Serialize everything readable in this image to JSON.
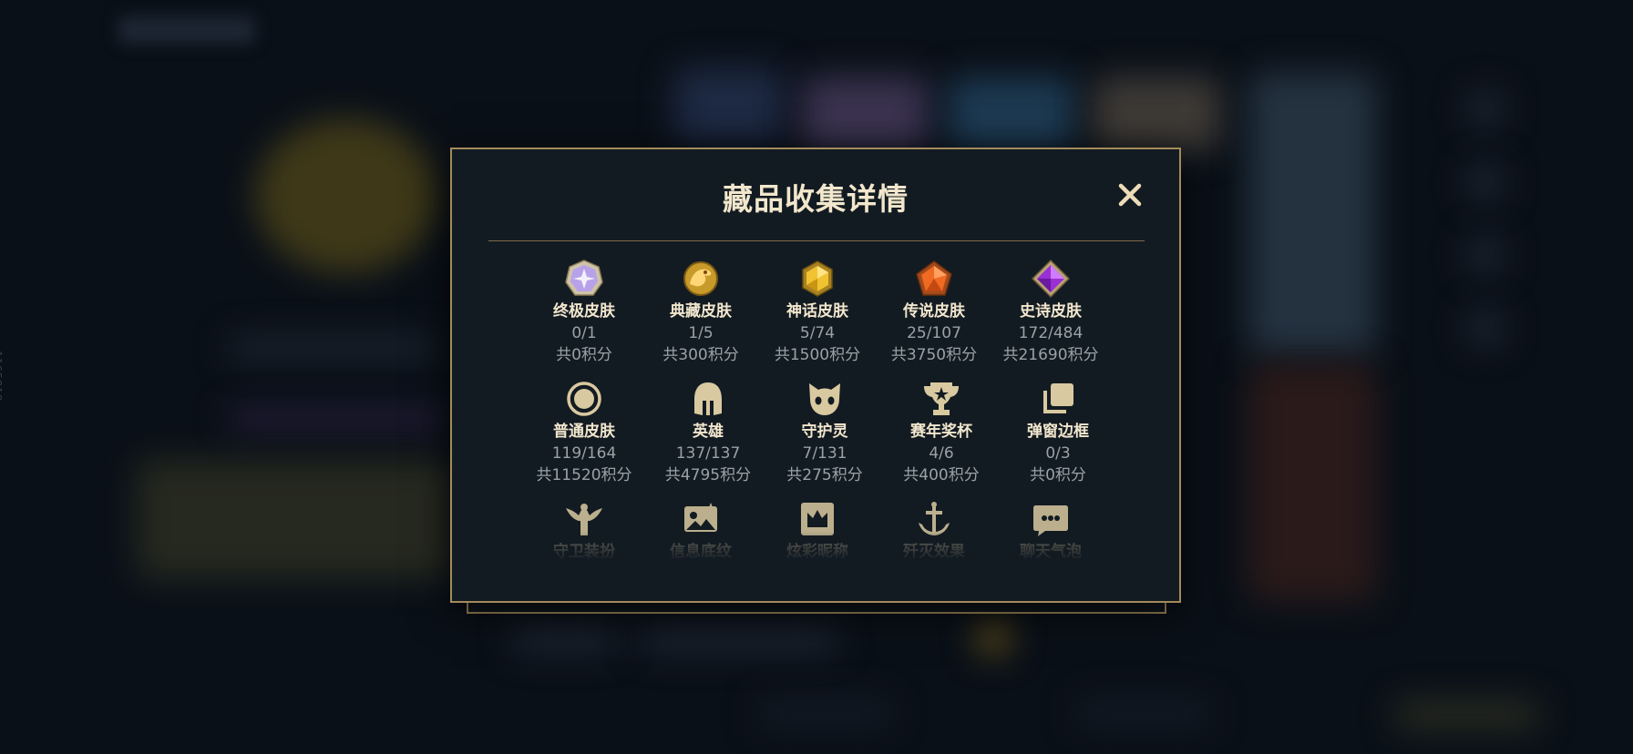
{
  "side_id": "1165818",
  "modal": {
    "title": "藏品收集详情"
  },
  "colors": {
    "gold": "#a48a5a",
    "title": "#f2e7cc",
    "muted": "#9aa2a8"
  },
  "items": [
    {
      "name": "终极皮肤",
      "count": "0/1",
      "points": "共0积分",
      "icon": "ultimate-gem-icon"
    },
    {
      "name": "典藏皮肤",
      "count": "1/5",
      "points": "共300积分",
      "icon": "dragon-gem-icon"
    },
    {
      "name": "神话皮肤",
      "count": "5/74",
      "points": "共1500积分",
      "icon": "mythic-gem-icon"
    },
    {
      "name": "传说皮肤",
      "count": "25/107",
      "points": "共3750积分",
      "icon": "legendary-gem-icon"
    },
    {
      "name": "史诗皮肤",
      "count": "172/484",
      "points": "共21690积分",
      "icon": "epic-gem-icon"
    },
    {
      "name": "普通皮肤",
      "count": "119/164",
      "points": "共11520积分",
      "icon": "circle-icon"
    },
    {
      "name": "英雄",
      "count": "137/137",
      "points": "共4795积分",
      "icon": "helmet-icon"
    },
    {
      "name": "守护灵",
      "count": "7/131",
      "points": "共275积分",
      "icon": "cat-face-icon"
    },
    {
      "name": "赛年奖杯",
      "count": "4/6",
      "points": "共400积分",
      "icon": "trophy-icon"
    },
    {
      "name": "弹窗边框",
      "count": "0/3",
      "points": "共0积分",
      "icon": "stacked-frames-icon"
    },
    {
      "name": "守卫装扮",
      "icon": "ward-icon"
    },
    {
      "name": "信息底纹",
      "icon": "banner-image-icon"
    },
    {
      "name": "炫彩昵称",
      "icon": "crown-badge-icon"
    },
    {
      "name": "歼灭效果",
      "icon": "anchor-icon"
    },
    {
      "name": "聊天气泡",
      "icon": "chat-bubble-icon"
    }
  ]
}
